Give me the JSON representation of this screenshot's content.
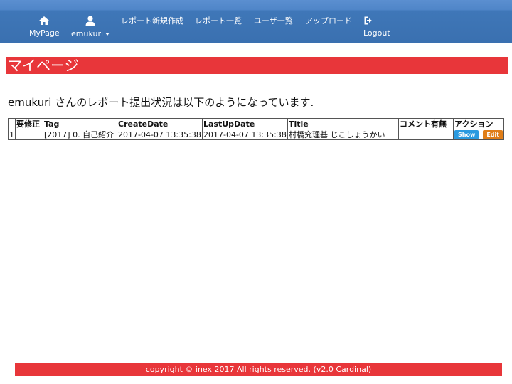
{
  "nav": {
    "mypage": "MyPage",
    "user": "emukuri",
    "new_report": "レポート新規作成",
    "report_list": "レポート一覧",
    "user_list": "ユーザ一覧",
    "upload": "アップロード",
    "logout": "Logout",
    "icons": [
      "home-icon",
      "user-icon",
      "logout-icon"
    ]
  },
  "page": {
    "heading": "マイページ",
    "status_user": "emukuri",
    "status_text": " さんのレポート提出状況は以下のようになっています."
  },
  "table": {
    "headers": [
      "",
      "要修正",
      "Tag",
      "CreateDate",
      "LastUpDate",
      "Title",
      "コメント有無",
      "アクション"
    ],
    "rows": [
      {
        "no": "1",
        "fix": "",
        "tag": "[2017] 0. 自己紹介",
        "create": "2017-04-07 13:35:38",
        "update": "2017-04-07 13:35:38",
        "title": "村橋究理基 じこしょうかい",
        "comment": "",
        "show": "Show",
        "edit": "Edit"
      }
    ]
  },
  "footer": {
    "text": "copyright © inex 2017 All rights reserved. (v2.0 Cardinal)"
  },
  "colors": {
    "nav": "#3f77b8",
    "accent_red": "#e8363a",
    "show": "#2a9ae0",
    "edit": "#e07d17"
  }
}
